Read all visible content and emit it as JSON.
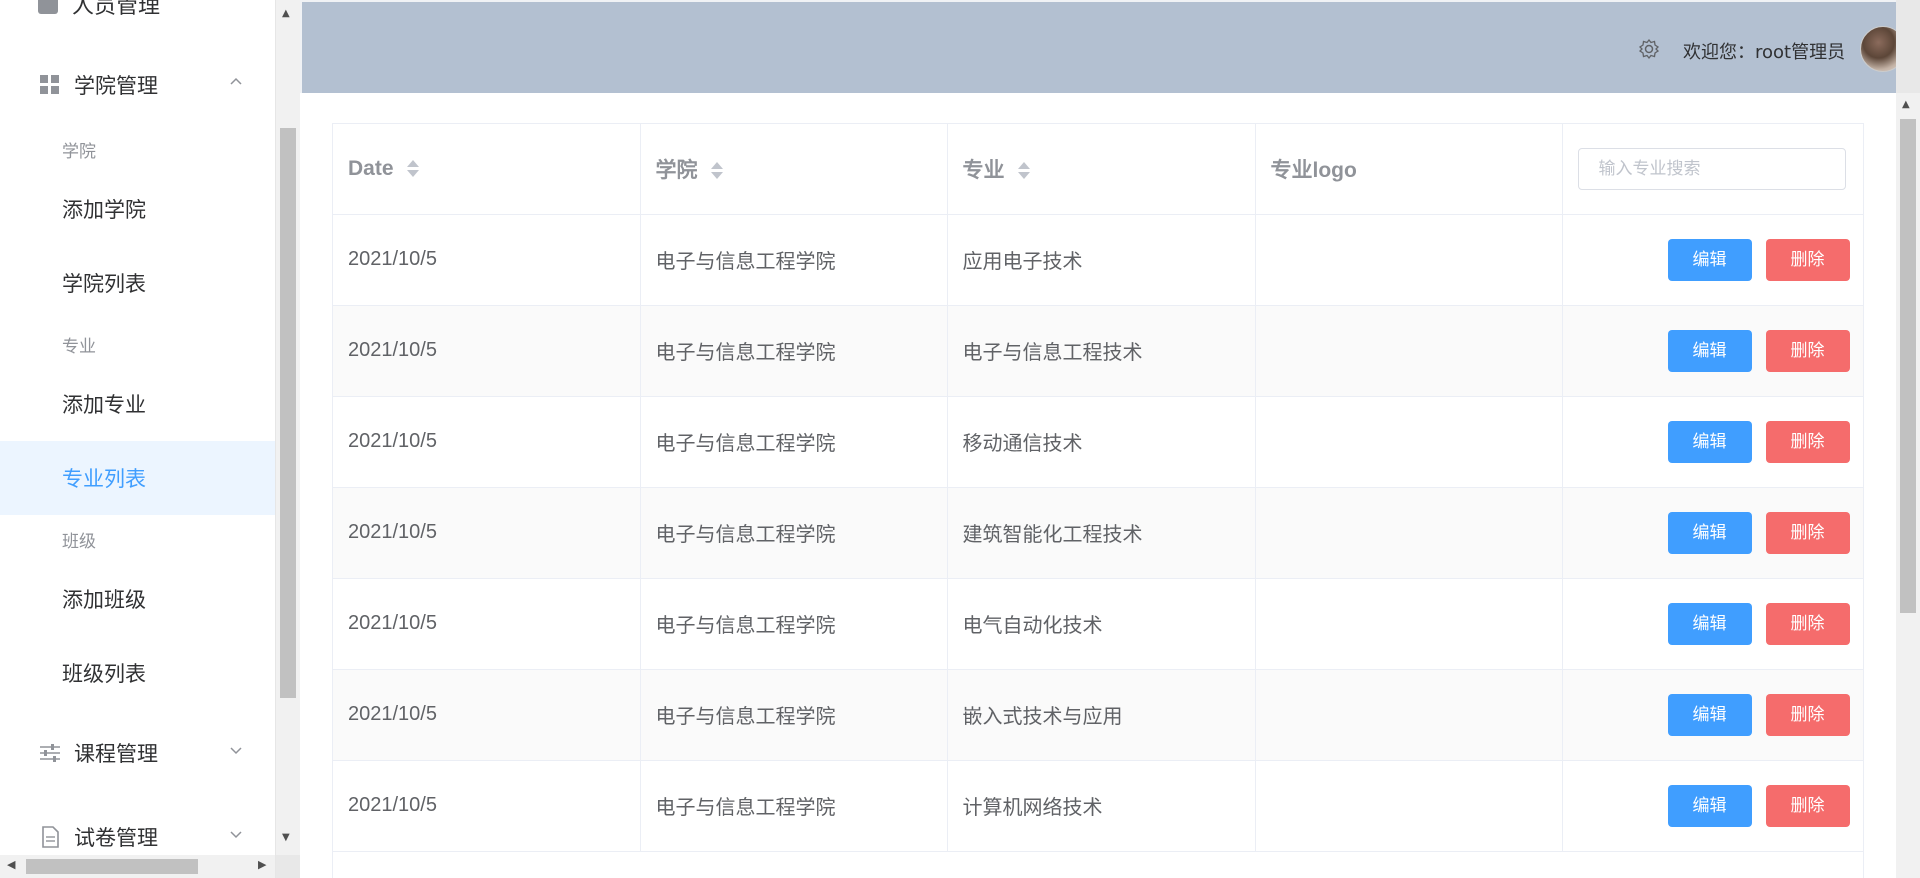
{
  "sidebar": {
    "partial_top_label": "人员管理",
    "college_menu": {
      "title": "学院管理",
      "groups": [
        {
          "title": "学院",
          "items": [
            {
              "label": "添加学院"
            },
            {
              "label": "学院列表"
            }
          ]
        },
        {
          "title": "专业",
          "items": [
            {
              "label": "添加专业"
            },
            {
              "label": "专业列表",
              "active": true
            }
          ]
        },
        {
          "title": "班级",
          "items": [
            {
              "label": "添加班级"
            },
            {
              "label": "班级列表"
            }
          ]
        }
      ]
    },
    "course_menu": {
      "title": "课程管理"
    },
    "exam_menu": {
      "title": "试卷管理"
    }
  },
  "header": {
    "welcome": "欢迎您：root管理员",
    "settings_icon": "gear-icon",
    "avatar": "avatar-image"
  },
  "table": {
    "columns": [
      {
        "label": "Date",
        "sortable": true
      },
      {
        "label": "学院",
        "sortable": true
      },
      {
        "label": "专业",
        "sortable": true
      },
      {
        "label": "专业logo",
        "sortable": false
      }
    ],
    "search_placeholder": "输入专业搜索",
    "edit_label": "编辑",
    "delete_label": "删除",
    "rows": [
      {
        "date": "2021/10/5",
        "college": "电子与信息工程学院",
        "major": "应用电子技术",
        "logo": ""
      },
      {
        "date": "2021/10/5",
        "college": "电子与信息工程学院",
        "major": "电子与信息工程技术",
        "logo": ""
      },
      {
        "date": "2021/10/5",
        "college": "电子与信息工程学院",
        "major": "移动通信技术",
        "logo": ""
      },
      {
        "date": "2021/10/5",
        "college": "电子与信息工程学院",
        "major": "建筑智能化工程技术",
        "logo": ""
      },
      {
        "date": "2021/10/5",
        "college": "电子与信息工程学院",
        "major": "电气自动化技术",
        "logo": ""
      },
      {
        "date": "2021/10/5",
        "college": "电子与信息工程学院",
        "major": "嵌入式技术与应用",
        "logo": ""
      },
      {
        "date": "2021/10/5",
        "college": "电子与信息工程学院",
        "major": "计算机网络技术",
        "logo": ""
      }
    ]
  },
  "colors": {
    "header_bg": "#b3c0d1",
    "accent": "#409eff",
    "danger": "#f56c6c",
    "active_bg": "#ecf5ff"
  }
}
